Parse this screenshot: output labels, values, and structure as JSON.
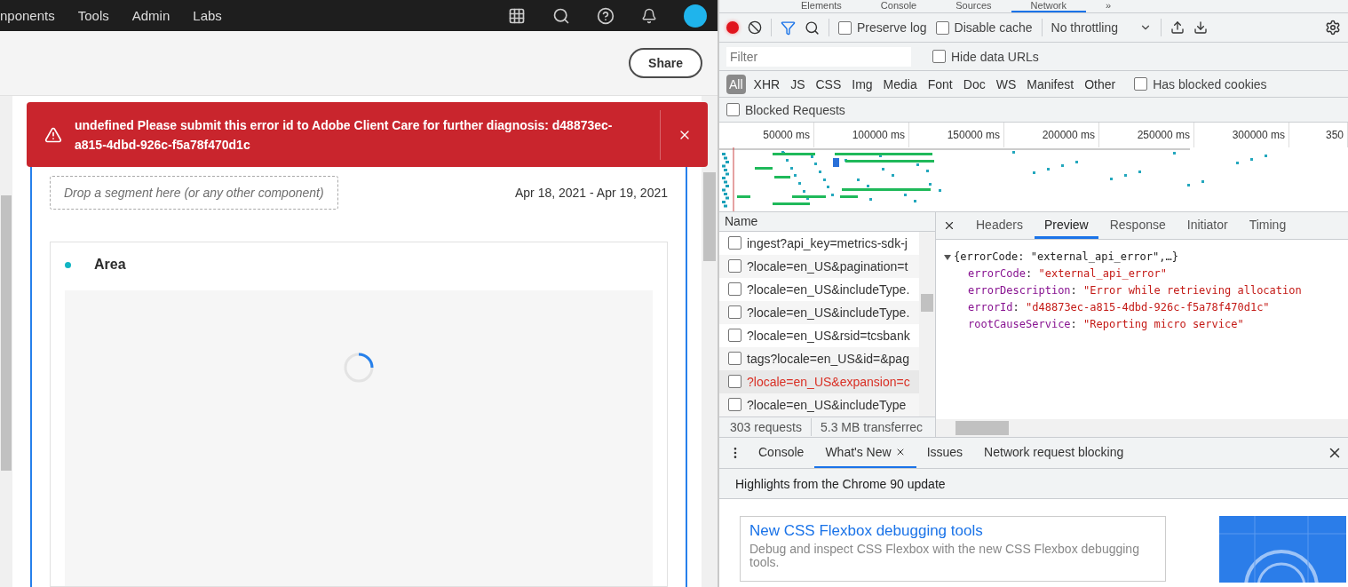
{
  "app": {
    "nav": [
      "nponents",
      "Tools",
      "Admin",
      "Labs"
    ],
    "share": "Share",
    "banner": {
      "message": "undefined Please submit this error id to Adobe Client Care for further diagnosis: d48873ec-a815-4dbd-926c-f5a78f470d1c"
    },
    "segment_placeholder": "Drop a segment here (or any other component)",
    "date_range": "Apr 18, 2021 - Apr 19, 2021",
    "card": {
      "title": "Area",
      "loading": true
    }
  },
  "devtools": {
    "tabs": [
      {
        "label": "Elements",
        "selected": false
      },
      {
        "label": "Console",
        "selected": false
      },
      {
        "label": "Sources",
        "selected": false
      },
      {
        "label": "Network",
        "selected": true
      }
    ],
    "more": "»",
    "toolbar": {
      "recording": true,
      "filter_on": true,
      "preserve_log": {
        "label": "Preserve log",
        "checked": false
      },
      "disable_cache": {
        "label": "Disable cache",
        "checked": false
      },
      "throttling": "No throttling"
    },
    "filter": {
      "placeholder": "Filter"
    },
    "hide_data_urls": {
      "label": "Hide data URLs",
      "checked": false
    },
    "types": [
      {
        "label": "All",
        "selected": true
      },
      {
        "label": "XHR",
        "selected": false
      },
      {
        "label": "JS",
        "selected": false
      },
      {
        "label": "CSS",
        "selected": false
      },
      {
        "label": "Img",
        "selected": false
      },
      {
        "label": "Media",
        "selected": false
      },
      {
        "label": "Font",
        "selected": false
      },
      {
        "label": "Doc",
        "selected": false
      },
      {
        "label": "WS",
        "selected": false
      },
      {
        "label": "Manifest",
        "selected": false
      },
      {
        "label": "Other",
        "selected": false
      }
    ],
    "has_blocked_cookies": {
      "label": "Has blocked cookies",
      "checked": false
    },
    "blocked_requests": {
      "label": "Blocked Requests",
      "checked": false
    },
    "timeline": {
      "ticks": [
        "50000 ms",
        "100000 ms",
        "150000 ms",
        "200000 ms",
        "250000 ms",
        "300000 ms",
        "350"
      ]
    },
    "requests": {
      "header": "Name",
      "rows": [
        {
          "name": "ingest?api_key=metrics-sdk-j",
          "error": false,
          "selected": false
        },
        {
          "name": "?locale=en_US&pagination=t",
          "error": false,
          "selected": false
        },
        {
          "name": "?locale=en_US&includeType.",
          "error": false,
          "selected": false
        },
        {
          "name": "?locale=en_US&includeType.",
          "error": false,
          "selected": false
        },
        {
          "name": "?locale=en_US&rsid=tcsbank",
          "error": false,
          "selected": false
        },
        {
          "name": "tags?locale=en_US&id=&pag",
          "error": false,
          "selected": false
        },
        {
          "name": "?locale=en_US&expansion=c",
          "error": true,
          "selected": true
        },
        {
          "name": "?locale=en_US&includeType",
          "error": false,
          "selected": false
        }
      ],
      "summary": [
        "303 requests",
        "5.3 MB transferrec"
      ]
    },
    "detail": {
      "tabs": [
        {
          "label": "Headers",
          "selected": false
        },
        {
          "label": "Preview",
          "selected": true
        },
        {
          "label": "Response",
          "selected": false
        },
        {
          "label": "Initiator",
          "selected": false
        },
        {
          "label": "Timing",
          "selected": false
        }
      ],
      "preview": {
        "separator": ":",
        "summary": "{errorCode: \"external_api_error\",…}",
        "expanded": true,
        "fields": [
          {
            "key": "errorCode",
            "value": "\"external_api_error\""
          },
          {
            "key": "errorDescription",
            "value": "\"Error while retrieving allocation"
          },
          {
            "key": "errorId",
            "value": "\"d48873ec-a815-4dbd-926c-f5a78f470d1c\""
          },
          {
            "key": "rootCauseService",
            "value": "\"Reporting micro service\""
          }
        ]
      }
    },
    "drawer": {
      "tabs": [
        {
          "label": "Console",
          "selected": false,
          "closable": false
        },
        {
          "label": "What's New",
          "selected": true,
          "closable": true
        },
        {
          "label": "Issues",
          "selected": false,
          "closable": false
        },
        {
          "label": "Network request blocking",
          "selected": false,
          "closable": false
        }
      ],
      "heading": "Highlights from the Chrome 90 update",
      "feature": {
        "title": "New CSS Flexbox debugging tools",
        "description": "Debug and inspect CSS Flexbox with the new CSS Flexbox debugging tools."
      }
    }
  }
}
